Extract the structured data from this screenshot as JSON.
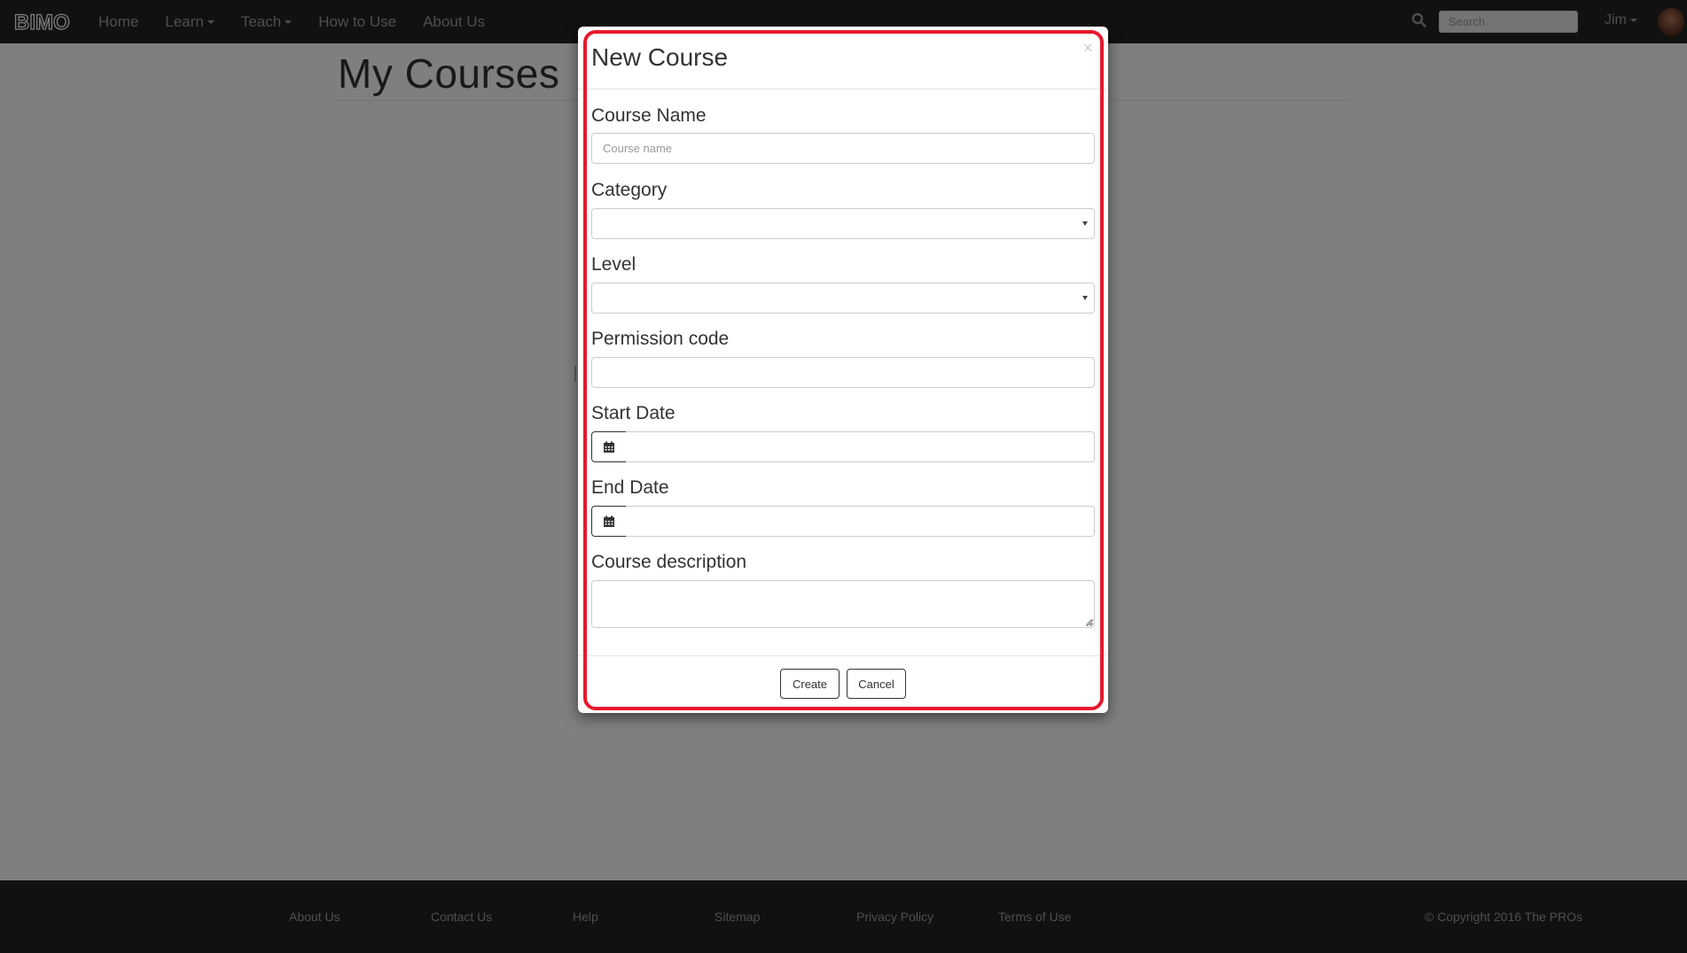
{
  "navbar": {
    "logo_text": "BIMO",
    "links": [
      {
        "label": "Home"
      },
      {
        "label": "Learn"
      },
      {
        "label": "Teach"
      },
      {
        "label": "How to Use"
      },
      {
        "label": "About Us"
      }
    ],
    "search_placeholder": "Search",
    "user_name": "Jim"
  },
  "page": {
    "title": "My Courses"
  },
  "modal": {
    "title": "New Course",
    "close_symbol": "×",
    "fields": {
      "course_name": {
        "label": "Course Name",
        "placeholder": "Course name",
        "value": ""
      },
      "category": {
        "label": "Category",
        "value": ""
      },
      "level": {
        "label": "Level",
        "value": ""
      },
      "permission_code": {
        "label": "Permission code",
        "value": ""
      },
      "start_date": {
        "label": "Start Date",
        "value": ""
      },
      "end_date": {
        "label": "End Date",
        "value": ""
      },
      "course_description": {
        "label": "Course description",
        "value": ""
      }
    },
    "buttons": {
      "create": "Create",
      "cancel": "Cancel"
    }
  },
  "footer": {
    "links": [
      {
        "label": "About Us"
      },
      {
        "label": "Contact Us"
      },
      {
        "label": "Help"
      },
      {
        "label": "Sitemap"
      },
      {
        "label": "Privacy Policy"
      },
      {
        "label": "Terms of Use"
      }
    ],
    "copyright": "© Copyright 2016 The PROs"
  },
  "colors": {
    "navbar_bg": "#222222",
    "nav_text": "#9d9d9d",
    "highlight_border": "#e8182b",
    "backdrop": "rgba(0,0,0,0.5)"
  },
  "icons": [
    "logo",
    "search-icon",
    "caret-down-icon",
    "avatar",
    "close-icon",
    "calendar-icon",
    "resize-grip-icon"
  ]
}
